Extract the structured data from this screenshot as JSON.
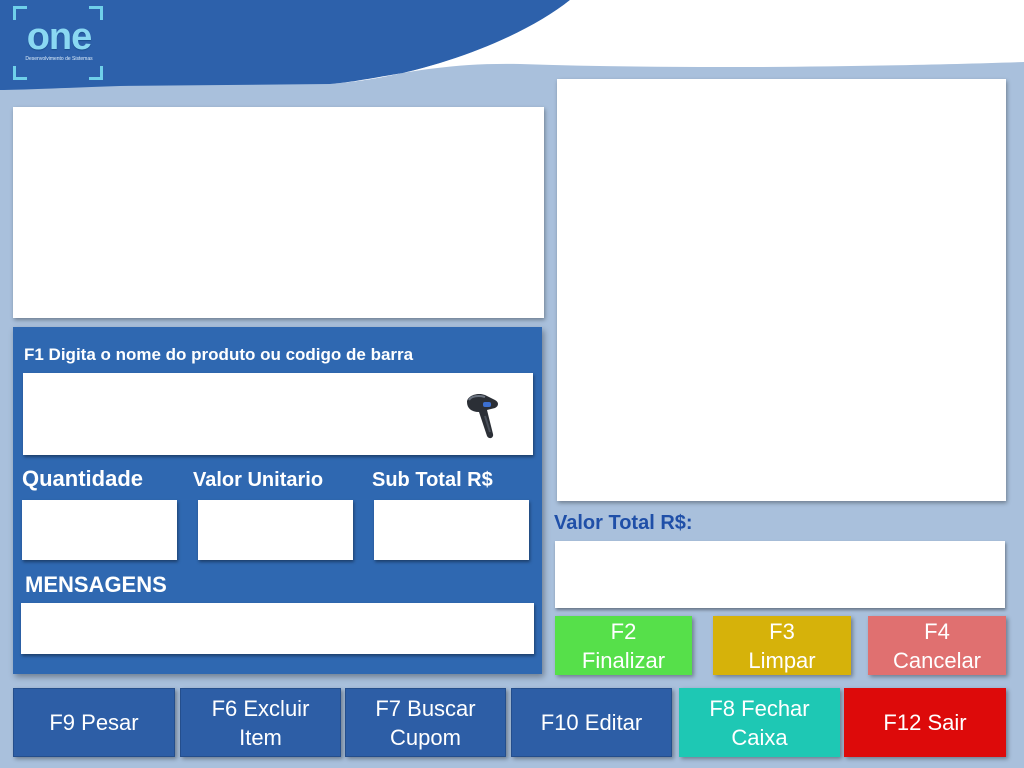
{
  "logo": {
    "text": "one",
    "subtext": "Desenvolvimento de Sistemas"
  },
  "search": {
    "label": "F1 Digita o nome do produto ou codigo de barra",
    "value": "",
    "scanner_icon": "barcode-scanner-icon"
  },
  "fields": {
    "quantidade_label": "Quantidade",
    "valor_unitario_label": "Valor Unitario",
    "sub_total_label": "Sub Total R$",
    "quantidade_value": "",
    "valor_unitario_value": "",
    "sub_total_value": ""
  },
  "mensagens": {
    "label": "MENSAGENS",
    "value": ""
  },
  "total": {
    "label": "Valor Total R$:",
    "value": ""
  },
  "actions": {
    "finalizar": "F2\nFinalizar",
    "limpar": "F3\nLimpar",
    "cancelar": "F4\nCancelar"
  },
  "bottom_buttons": {
    "pesar": "F9 Pesar",
    "excluir": "F6 Excluir\nItem",
    "buscar": "F7 Buscar\nCupom",
    "editar": "F10 Editar",
    "fechar": "F8 Fechar\nCaixa",
    "sair": "F12 Sair"
  },
  "colors": {
    "primary_blue": "#2d5ea6",
    "finalizar": "#56e04a",
    "limpar": "#d6b20a",
    "cancelar": "#e07070",
    "fechar": "#1ec8b4",
    "sair": "#dd0a0a",
    "total_label": "#1f4fa8"
  }
}
